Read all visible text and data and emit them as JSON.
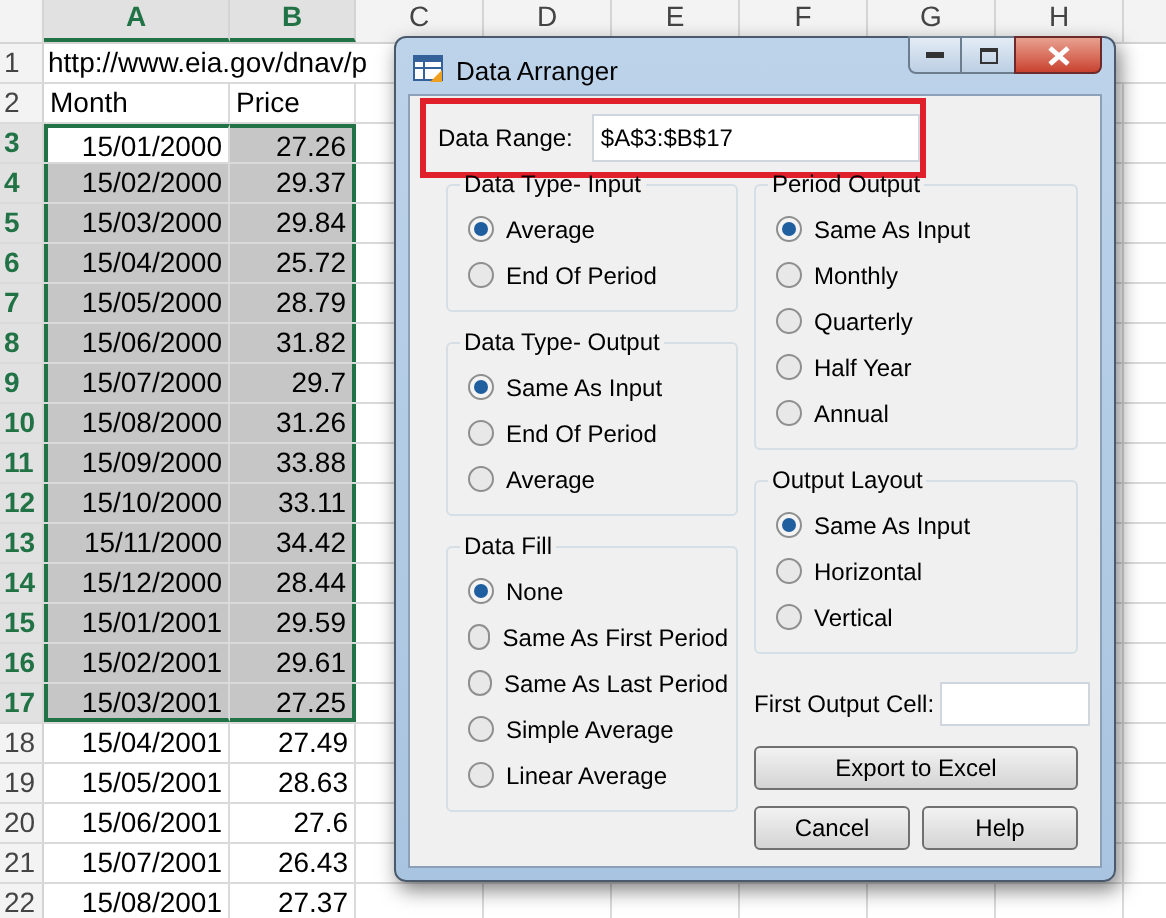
{
  "spreadsheet": {
    "columns": [
      {
        "label": "A",
        "selected": true
      },
      {
        "label": "B",
        "selected": true
      },
      {
        "label": "C",
        "selected": false
      },
      {
        "label": "D",
        "selected": false
      },
      {
        "label": "E",
        "selected": false
      },
      {
        "label": "F",
        "selected": false
      },
      {
        "label": "G",
        "selected": false
      },
      {
        "label": "H",
        "selected": false
      }
    ],
    "rows": [
      {
        "number": "1",
        "selected": false,
        "overflow": true,
        "cells": [
          "http://www.eia.gov/dnav/p"
        ]
      },
      {
        "number": "2",
        "selected": false,
        "cells": [
          "Month",
          "Price"
        ]
      },
      {
        "number": "3",
        "selected": true,
        "cells": [
          {
            "text": "15/01/2000",
            "active": true
          },
          "27.26"
        ]
      },
      {
        "number": "4",
        "selected": true,
        "cells": [
          "15/02/2000",
          "29.37"
        ]
      },
      {
        "number": "5",
        "selected": true,
        "cells": [
          "15/03/2000",
          "29.84"
        ]
      },
      {
        "number": "6",
        "selected": true,
        "cells": [
          "15/04/2000",
          "25.72"
        ]
      },
      {
        "number": "7",
        "selected": true,
        "cells": [
          "15/05/2000",
          "28.79"
        ]
      },
      {
        "number": "8",
        "selected": true,
        "cells": [
          "15/06/2000",
          "31.82"
        ]
      },
      {
        "number": "9",
        "selected": true,
        "cells": [
          "15/07/2000",
          "29.7"
        ]
      },
      {
        "number": "10",
        "selected": true,
        "cells": [
          "15/08/2000",
          "31.26"
        ]
      },
      {
        "number": "11",
        "selected": true,
        "cells": [
          "15/09/2000",
          "33.88"
        ]
      },
      {
        "number": "12",
        "selected": true,
        "cells": [
          "15/10/2000",
          "33.11"
        ]
      },
      {
        "number": "13",
        "selected": true,
        "cells": [
          "15/11/2000",
          "34.42"
        ]
      },
      {
        "number": "14",
        "selected": true,
        "cells": [
          "15/12/2000",
          "28.44"
        ]
      },
      {
        "number": "15",
        "selected": true,
        "cells": [
          "15/01/2001",
          "29.59"
        ]
      },
      {
        "number": "16",
        "selected": true,
        "cells": [
          "15/02/2001",
          "29.61"
        ]
      },
      {
        "number": "17",
        "selected": true,
        "cells": [
          "15/03/2001",
          "27.25"
        ]
      },
      {
        "number": "18",
        "selected": false,
        "cells": [
          "15/04/2001",
          "27.49"
        ]
      },
      {
        "number": "19",
        "selected": false,
        "cells": [
          "15/05/2001",
          "28.63"
        ]
      },
      {
        "number": "20",
        "selected": false,
        "cells": [
          "15/06/2001",
          "27.6"
        ]
      },
      {
        "number": "21",
        "selected": false,
        "cells": [
          "15/07/2001",
          "26.43"
        ]
      },
      {
        "number": "22",
        "selected": false,
        "cells": [
          "15/08/2001",
          "27.37"
        ]
      }
    ]
  },
  "dialog": {
    "title": "Data Arranger",
    "data_range": {
      "label": "Data Range:",
      "value": "$A$3:$B$17"
    },
    "left_groups": [
      {
        "title": "Data Type- Input",
        "options": [
          {
            "label": "Average",
            "selected": true
          },
          {
            "label": "End Of Period",
            "selected": false
          }
        ]
      },
      {
        "title": "Data Type- Output",
        "options": [
          {
            "label": "Same As Input",
            "selected": true
          },
          {
            "label": "End Of Period",
            "selected": false
          },
          {
            "label": "Average",
            "selected": false
          }
        ]
      },
      {
        "title": "Data Fill",
        "options": [
          {
            "label": "None",
            "selected": true
          },
          {
            "label": "Same As First Period",
            "selected": false
          },
          {
            "label": "Same As Last Period",
            "selected": false
          },
          {
            "label": "Simple Average",
            "selected": false
          },
          {
            "label": "Linear Average",
            "selected": false
          }
        ]
      }
    ],
    "right_groups": [
      {
        "title": "Period Output",
        "options": [
          {
            "label": "Same As Input",
            "selected": true
          },
          {
            "label": "Monthly",
            "selected": false
          },
          {
            "label": "Quarterly",
            "selected": false
          },
          {
            "label": "Half Year",
            "selected": false
          },
          {
            "label": "Annual",
            "selected": false
          }
        ]
      },
      {
        "title": "Output Layout",
        "options": [
          {
            "label": "Same As Input",
            "selected": true
          },
          {
            "label": "Horizontal",
            "selected": false
          },
          {
            "label": "Vertical",
            "selected": false
          }
        ]
      }
    ],
    "first_output_cell": {
      "label": "First Output Cell:"
    },
    "buttons": [
      "Export to Excel",
      "Cancel",
      "Help"
    ]
  }
}
